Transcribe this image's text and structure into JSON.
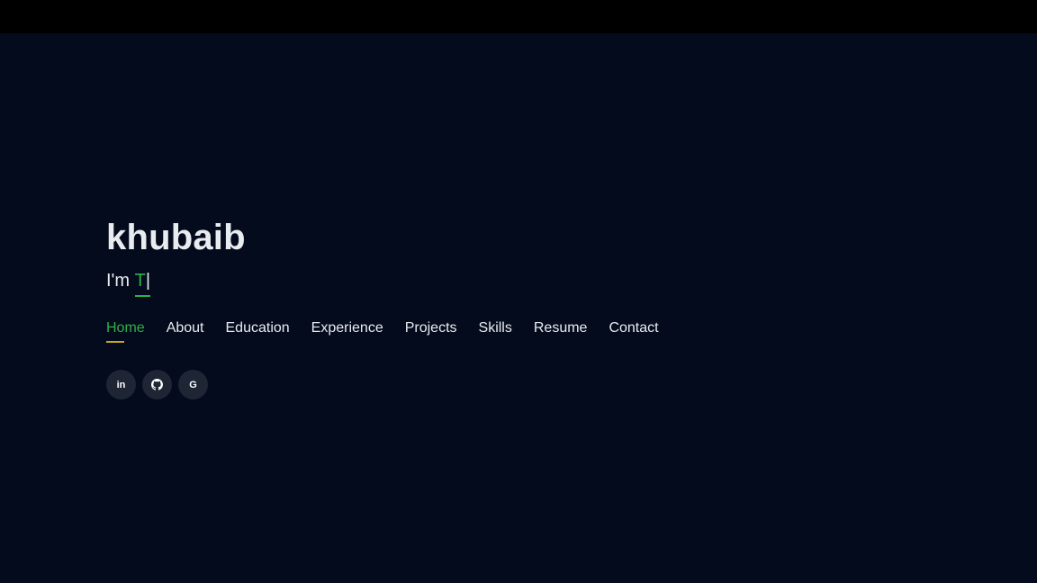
{
  "hero": {
    "name": "khubaib",
    "typed_prefix": "I'm ",
    "typed_word": "T",
    "cursor": "|"
  },
  "nav": {
    "items": [
      {
        "label": "Home",
        "active": true
      },
      {
        "label": "About"
      },
      {
        "label": "Education"
      },
      {
        "label": "Experience"
      },
      {
        "label": "Projects"
      },
      {
        "label": "Skills"
      },
      {
        "label": "Resume"
      },
      {
        "label": "Contact"
      }
    ]
  },
  "socials": [
    {
      "icon": "linkedin-icon",
      "glyph": "in"
    },
    {
      "icon": "github-icon"
    },
    {
      "icon": "google-icon",
      "glyph": "G"
    }
  ],
  "colors": {
    "background": "#040b1c",
    "topbar": "#000000",
    "accent": "#2fb04a",
    "underline": "#c9a227",
    "text": "#e8ebf0",
    "social_bg": "#1e2636"
  }
}
